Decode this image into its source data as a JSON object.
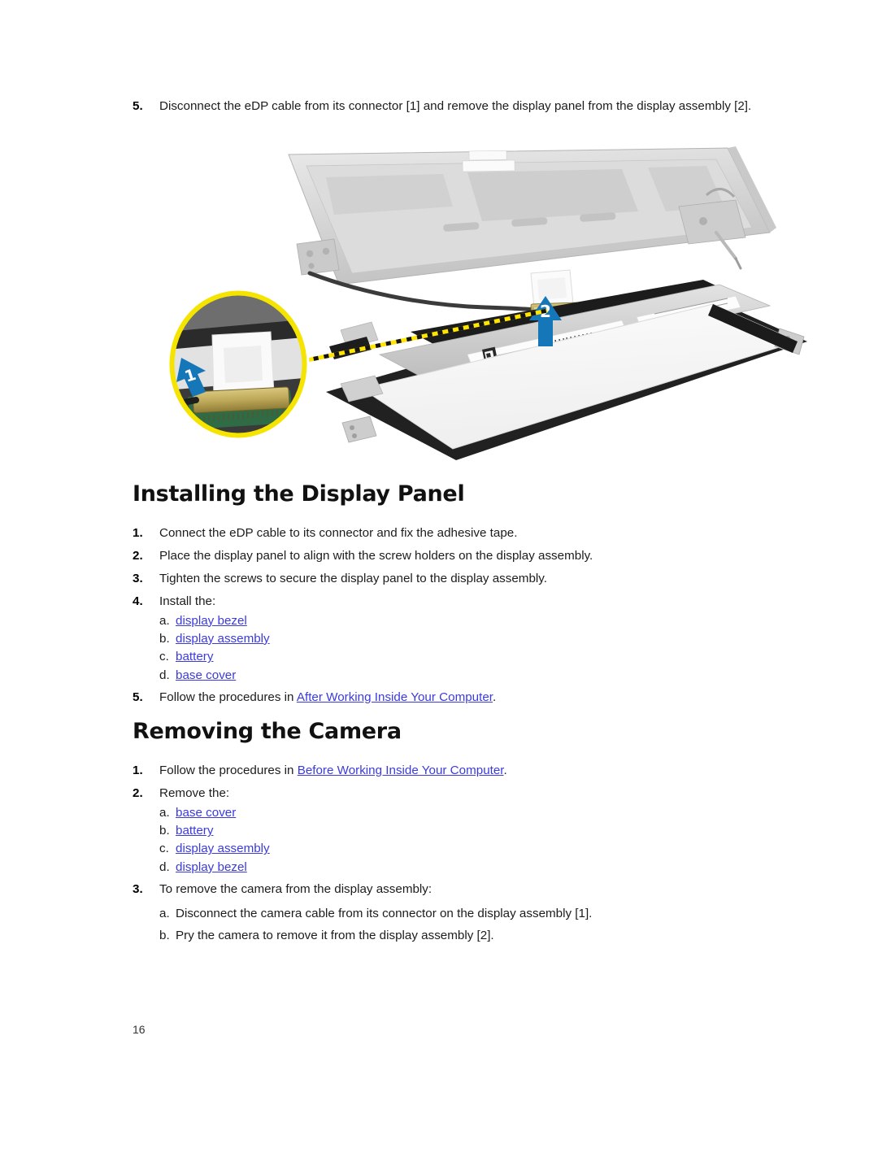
{
  "document": {
    "page_number": "16"
  },
  "top_step": {
    "number": "5.",
    "text": "Disconnect the eDP cable from its connector [1] and remove the display panel from the display assembly [2]."
  },
  "figure": {
    "name": "display-panel-removal-figure",
    "callout_1": "1",
    "callout_2": "2",
    "colors": {
      "arrow_blue": "#1577b8",
      "callout_yellow": "#f5e400",
      "leader_yellow": "#ffe500",
      "panel_bezel": "#1f1f1f",
      "panel_face": "#f4f4f4",
      "cover_gray": "#d3d3d3"
    }
  },
  "sections": [
    {
      "heading": "Installing the Display Panel",
      "steps": [
        {
          "number": "1.",
          "text": "Connect the eDP cable to its connector and fix the adhesive tape."
        },
        {
          "number": "2.",
          "text": "Place the display panel to align with the screw holders on the display assembly."
        },
        {
          "number": "3.",
          "text": "Tighten the screws to secure the display panel to the display assembly."
        },
        {
          "number": "4.",
          "text": "Install the:",
          "substeps": [
            {
              "letter": "a.",
              "link": "display bezel"
            },
            {
              "letter": "b.",
              "link": "display assembly"
            },
            {
              "letter": "c.",
              "link": "battery"
            },
            {
              "letter": "d.",
              "link": "base cover"
            }
          ]
        },
        {
          "number": "5.",
          "prefix": "Follow the procedures in ",
          "link": "After Working Inside Your Computer",
          "suffix": "."
        }
      ]
    },
    {
      "heading": "Removing the Camera",
      "steps": [
        {
          "number": "1.",
          "prefix": "Follow the procedures in ",
          "link": "Before Working Inside Your Computer",
          "suffix": "."
        },
        {
          "number": "2.",
          "text": "Remove the:",
          "substeps": [
            {
              "letter": "a.",
              "link": "base cover"
            },
            {
              "letter": "b.",
              "link": "battery"
            },
            {
              "letter": "c.",
              "link": "display assembly"
            },
            {
              "letter": "d.",
              "link": "display bezel"
            }
          ]
        },
        {
          "number": "3.",
          "text": "To remove the camera from the display assembly:",
          "substeps": [
            {
              "letter": "a.",
              "text": "Disconnect the camera cable from its connector on the display assembly [1]."
            },
            {
              "letter": "b.",
              "text": "Pry the camera to remove it from the display assembly [2]."
            }
          ]
        }
      ]
    }
  ]
}
